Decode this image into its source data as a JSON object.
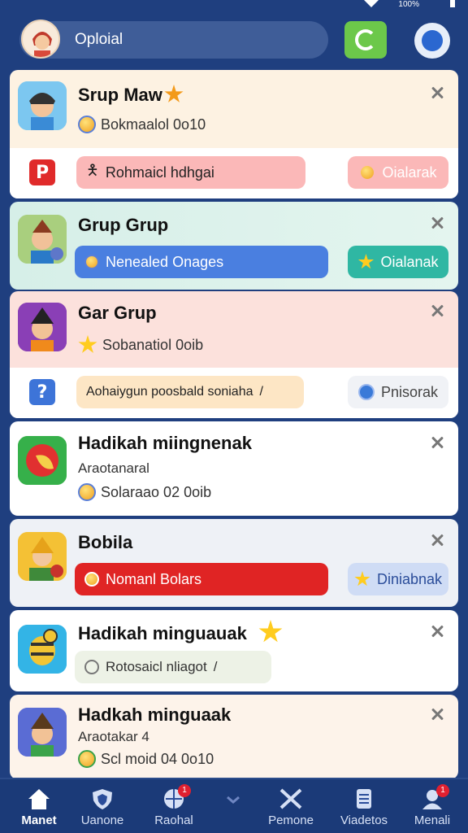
{
  "status": {
    "signal": "100%"
  },
  "header": {
    "search_text": "Oploial"
  },
  "cards": [
    {
      "title": "Srup Maw",
      "sub": "Bokmaalol 0o10",
      "pill_text": "Rohmaicl hdhgai",
      "right_btn": "Oialarak"
    },
    {
      "title": "Grup Grup",
      "pill_text": "Nenealed Onages",
      "right_btn": "Oialanak"
    },
    {
      "title": "Gar Grup",
      "sub": "Sobanatiol 0oib",
      "pill_text": "Aohaiygun poosbald soniaha",
      "right_btn": "Pnisorak"
    },
    {
      "title": "Hadikah miingnenak",
      "sub1": "Araotanaral",
      "sub2": "Solaraao 02 0oib"
    },
    {
      "title": "Bobila",
      "pill_text": "Nomanl Bolars",
      "right_btn": "Diniabnak"
    },
    {
      "title": "Hadikah minguauak",
      "pill_text": "Rotosaicl nliagot"
    },
    {
      "title": "Hadkah minguaak",
      "sub1": "Araotakar 4",
      "sub2": "Scl moid 04 0o10"
    }
  ],
  "nav": [
    {
      "label": "Manet"
    },
    {
      "label": "Uanone"
    },
    {
      "label": "Raohal",
      "badge": "1"
    },
    {
      "label": "Pemone"
    },
    {
      "label": "Viadetos"
    },
    {
      "label": "Menali",
      "badge": "1"
    }
  ],
  "colors": {
    "bg": "#1f3f7f",
    "accent_green": "#6cc84a",
    "red": "#e02424",
    "blue": "#4f7fe0",
    "teal": "#2bb8a6"
  }
}
